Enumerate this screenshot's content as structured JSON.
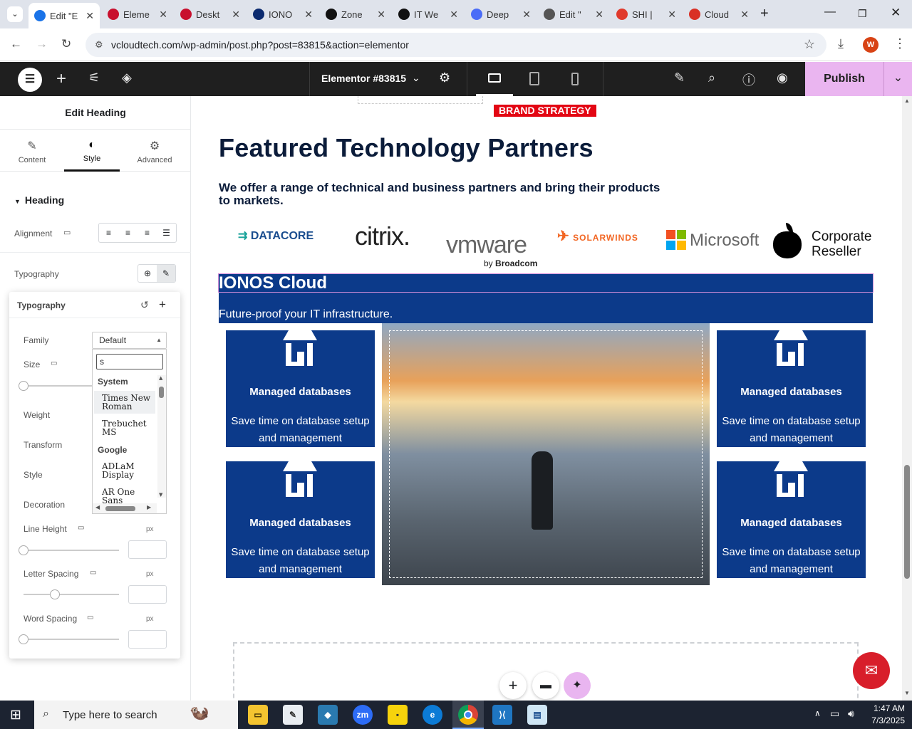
{
  "browser": {
    "tabs": [
      {
        "title": "Edit \"E",
        "color": "#1a73e8",
        "icon": "wordpress-icon",
        "active": true
      },
      {
        "title": "Eleme",
        "color": "#c8102e",
        "icon": "elementor-icon"
      },
      {
        "title": "Deskt",
        "color": "#c8102e",
        "icon": "elementor-icon"
      },
      {
        "title": "IONO",
        "color": "#0b2a6f",
        "icon": "ionos-icon"
      },
      {
        "title": "Zone",
        "color": "#111111",
        "icon": "zonos-icon"
      },
      {
        "title": "IT We",
        "color": "#111111",
        "icon": "chatgpt-icon"
      },
      {
        "title": "Deep",
        "color": "#4a6cf7",
        "icon": "deepseek-icon"
      },
      {
        "title": "Edit \"",
        "color": "#555555",
        "icon": "wordpress-icon"
      },
      {
        "title": "SHI | ",
        "color": "#e03a2c",
        "icon": "shi-icon"
      },
      {
        "title": "Cloud",
        "color": "#d93025",
        "icon": "cloud-icon"
      }
    ],
    "url": "vcloudtech.com/wp-admin/post.php?post=83815&action=elementor",
    "profile_initial": "W"
  },
  "topbar": {
    "document_title": "Elementor #83815",
    "publish_label": "Publish"
  },
  "panel": {
    "title": "Edit Heading",
    "tabs": [
      {
        "label": "Content",
        "icon": "pencil-icon"
      },
      {
        "label": "Style",
        "icon": "contrast-icon"
      },
      {
        "label": "Advanced",
        "icon": "gear-icon"
      }
    ],
    "section_heading": "Heading",
    "alignment_label": "Alignment",
    "typography_label": "Typography",
    "popup": {
      "title": "Typography",
      "family_label": "Family",
      "family_value": "Default",
      "size_label": "Size",
      "weight_label": "Weight",
      "transform_label": "Transform",
      "style_label": "Style",
      "decoration_label": "Decoration",
      "line_height_label": "Line Height",
      "letter_spacing_label": "Letter Spacing",
      "word_spacing_label": "Word Spacing",
      "unit": "px",
      "search_value": "s",
      "font_groups": [
        {
          "name": "System",
          "options": [
            "Times New Roman",
            "Trebuchet MS"
          ]
        },
        {
          "name": "Google",
          "options": [
            "ADLaM Display",
            "AR One Sans"
          ]
        }
      ]
    }
  },
  "page": {
    "brand_badge": "BRAND STRATEGY",
    "heading": "Featured Technology Partners",
    "subheading": "We offer a range of technical and business partners and bring their products to markets.",
    "logos": {
      "datacore": "DATACORE",
      "citrix": "citrix.",
      "vmware": "vmware",
      "vmware_sub": "by",
      "vmware_sub2": "Broadcom",
      "solarwinds": "SOLARWINDS",
      "microsoft": "Microsoft",
      "apple_line1": "Corporate",
      "apple_line2": "Reseller"
    },
    "banner_title": "IONOS Cloud",
    "banner_subtitle": "Future-proof your IT infrastructure.",
    "cards": [
      {
        "title": "Managed databases",
        "desc": "Save time on database setup and management"
      },
      {
        "title": "Managed databases",
        "desc": "Save time on database setup and management"
      },
      {
        "title": "Managed databases",
        "desc": "Save time on database setup and management"
      },
      {
        "title": "Managed databases",
        "desc": "Save time on database setup and management"
      }
    ],
    "accent": "#0c3a8a"
  },
  "taskbar": {
    "search_placeholder": "Type here to search",
    "time": "1:47 AM",
    "date": "7/3/2025"
  }
}
